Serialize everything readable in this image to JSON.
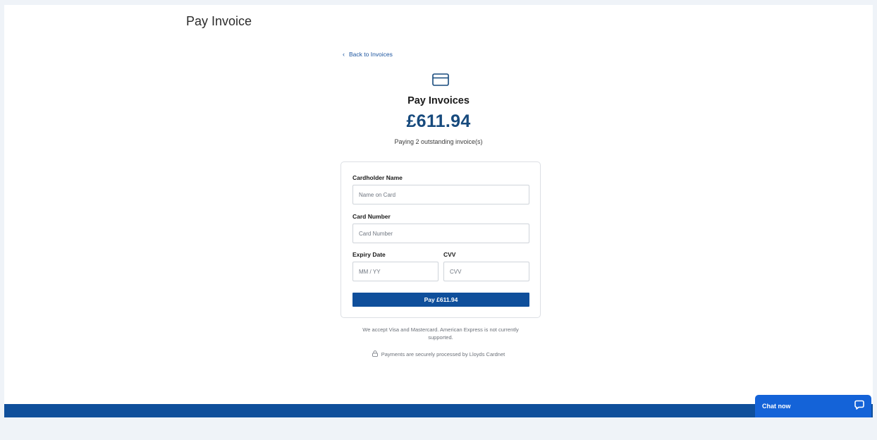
{
  "page": {
    "title": "Pay Invoice"
  },
  "nav": {
    "back_label": "Back to Invoices"
  },
  "summary": {
    "heading": "Pay Invoices",
    "amount": "£611.94",
    "subtext": "Paying 2 outstanding invoice(s)"
  },
  "form": {
    "cardholder": {
      "label": "Cardholder Name",
      "placeholder": "Name on Card",
      "value": ""
    },
    "card_number": {
      "label": "Card Number",
      "placeholder": "Card Number",
      "value": ""
    },
    "expiry": {
      "label": "Expiry Date",
      "placeholder": "MM / YY",
      "value": ""
    },
    "cvv": {
      "label": "CVV",
      "placeholder": "CVV",
      "value": ""
    },
    "pay_button_label": "Pay £611.94"
  },
  "notes": {
    "accepted_cards": "We accept Visa and Mastercard. American Express is not currently supported.",
    "secure": "Payments are securely processed by Lloyds Cardnet"
  },
  "chat": {
    "label": "Chat now"
  },
  "icons": {
    "back": "chevron-left-icon",
    "card": "credit-card-icon",
    "lock": "lock-icon",
    "chat": "chat-bubble-icon"
  },
  "colors": {
    "accent": "#0f4f9b",
    "amount": "#174a7d",
    "chat": "#1463d8",
    "link": "#1e56a0"
  }
}
